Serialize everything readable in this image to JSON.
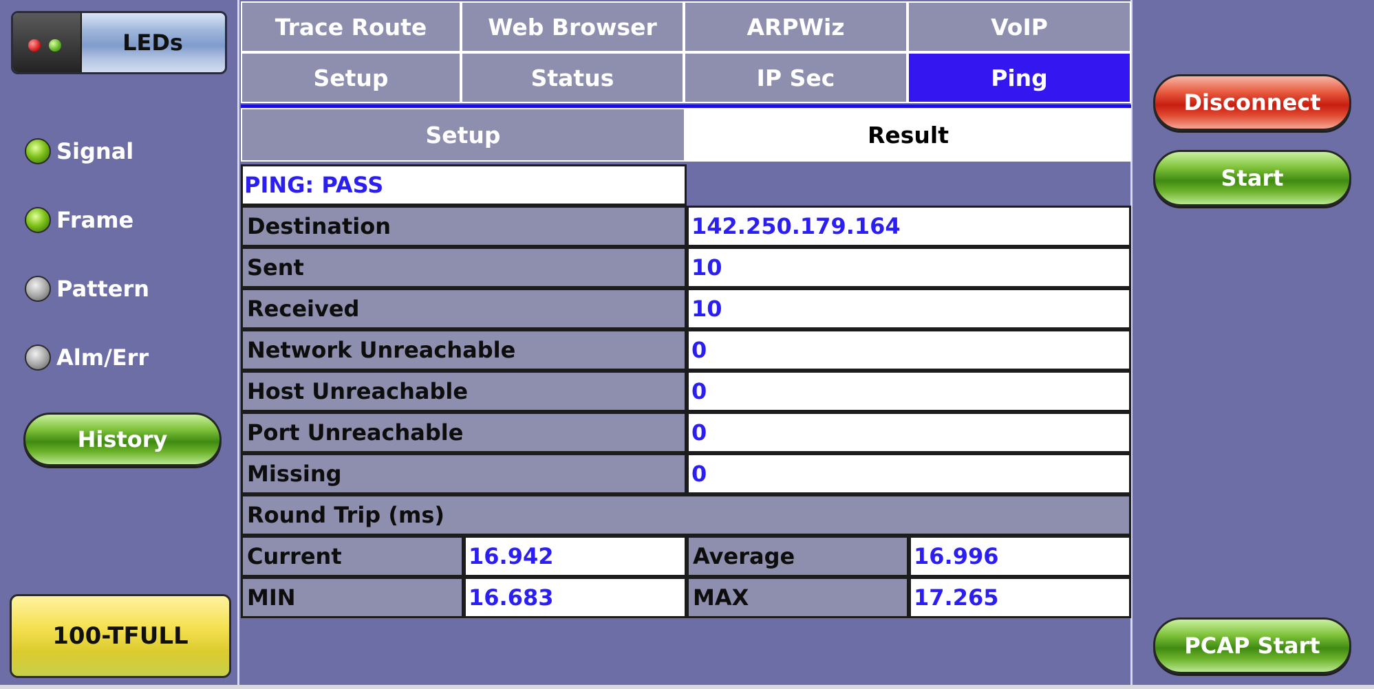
{
  "left_panel": {
    "leds_button": "LEDs",
    "indicators": [
      {
        "label": "Signal",
        "state": "green"
      },
      {
        "label": "Frame",
        "state": "green"
      },
      {
        "label": "Pattern",
        "state": "grey"
      },
      {
        "label": "Alm/Err",
        "state": "grey"
      }
    ],
    "history_button": "History",
    "link_status": "100-TFULL"
  },
  "tabs": {
    "row1": [
      "Trace Route",
      "Web Browser",
      "ARPWiz",
      "VoIP"
    ],
    "row2": [
      "Setup",
      "Status",
      "IP Sec",
      "Ping"
    ],
    "active_row2": "Ping"
  },
  "subtabs": {
    "items": [
      "Setup",
      "Result"
    ],
    "active": "Result"
  },
  "result": {
    "status": "PING: PASS",
    "rows": [
      {
        "label": "Destination",
        "value": "142.250.179.164"
      },
      {
        "label": "Sent",
        "value": "10"
      },
      {
        "label": "Received",
        "value": "10"
      },
      {
        "label": "Network Unreachable",
        "value": "0"
      },
      {
        "label": "Host Unreachable",
        "value": "0"
      },
      {
        "label": "Port Unreachable",
        "value": "0"
      },
      {
        "label": "Missing",
        "value": "0"
      }
    ],
    "round_trip": {
      "header": "Round Trip (ms)",
      "current_label": "Current",
      "current_value": "16.942",
      "average_label": "Average",
      "average_value": "16.996",
      "min_label": "MIN",
      "min_value": "16.683",
      "max_label": "MAX",
      "max_value": "17.265"
    }
  },
  "right_panel": {
    "disconnect_button": "Disconnect",
    "start_button": "Start",
    "pcap_button": "PCAP Start"
  },
  "colors": {
    "background": "#6e6ea6",
    "tab": "#8e8eae",
    "active_tab": "#3316f0",
    "value_text": "#2a1ef2"
  }
}
